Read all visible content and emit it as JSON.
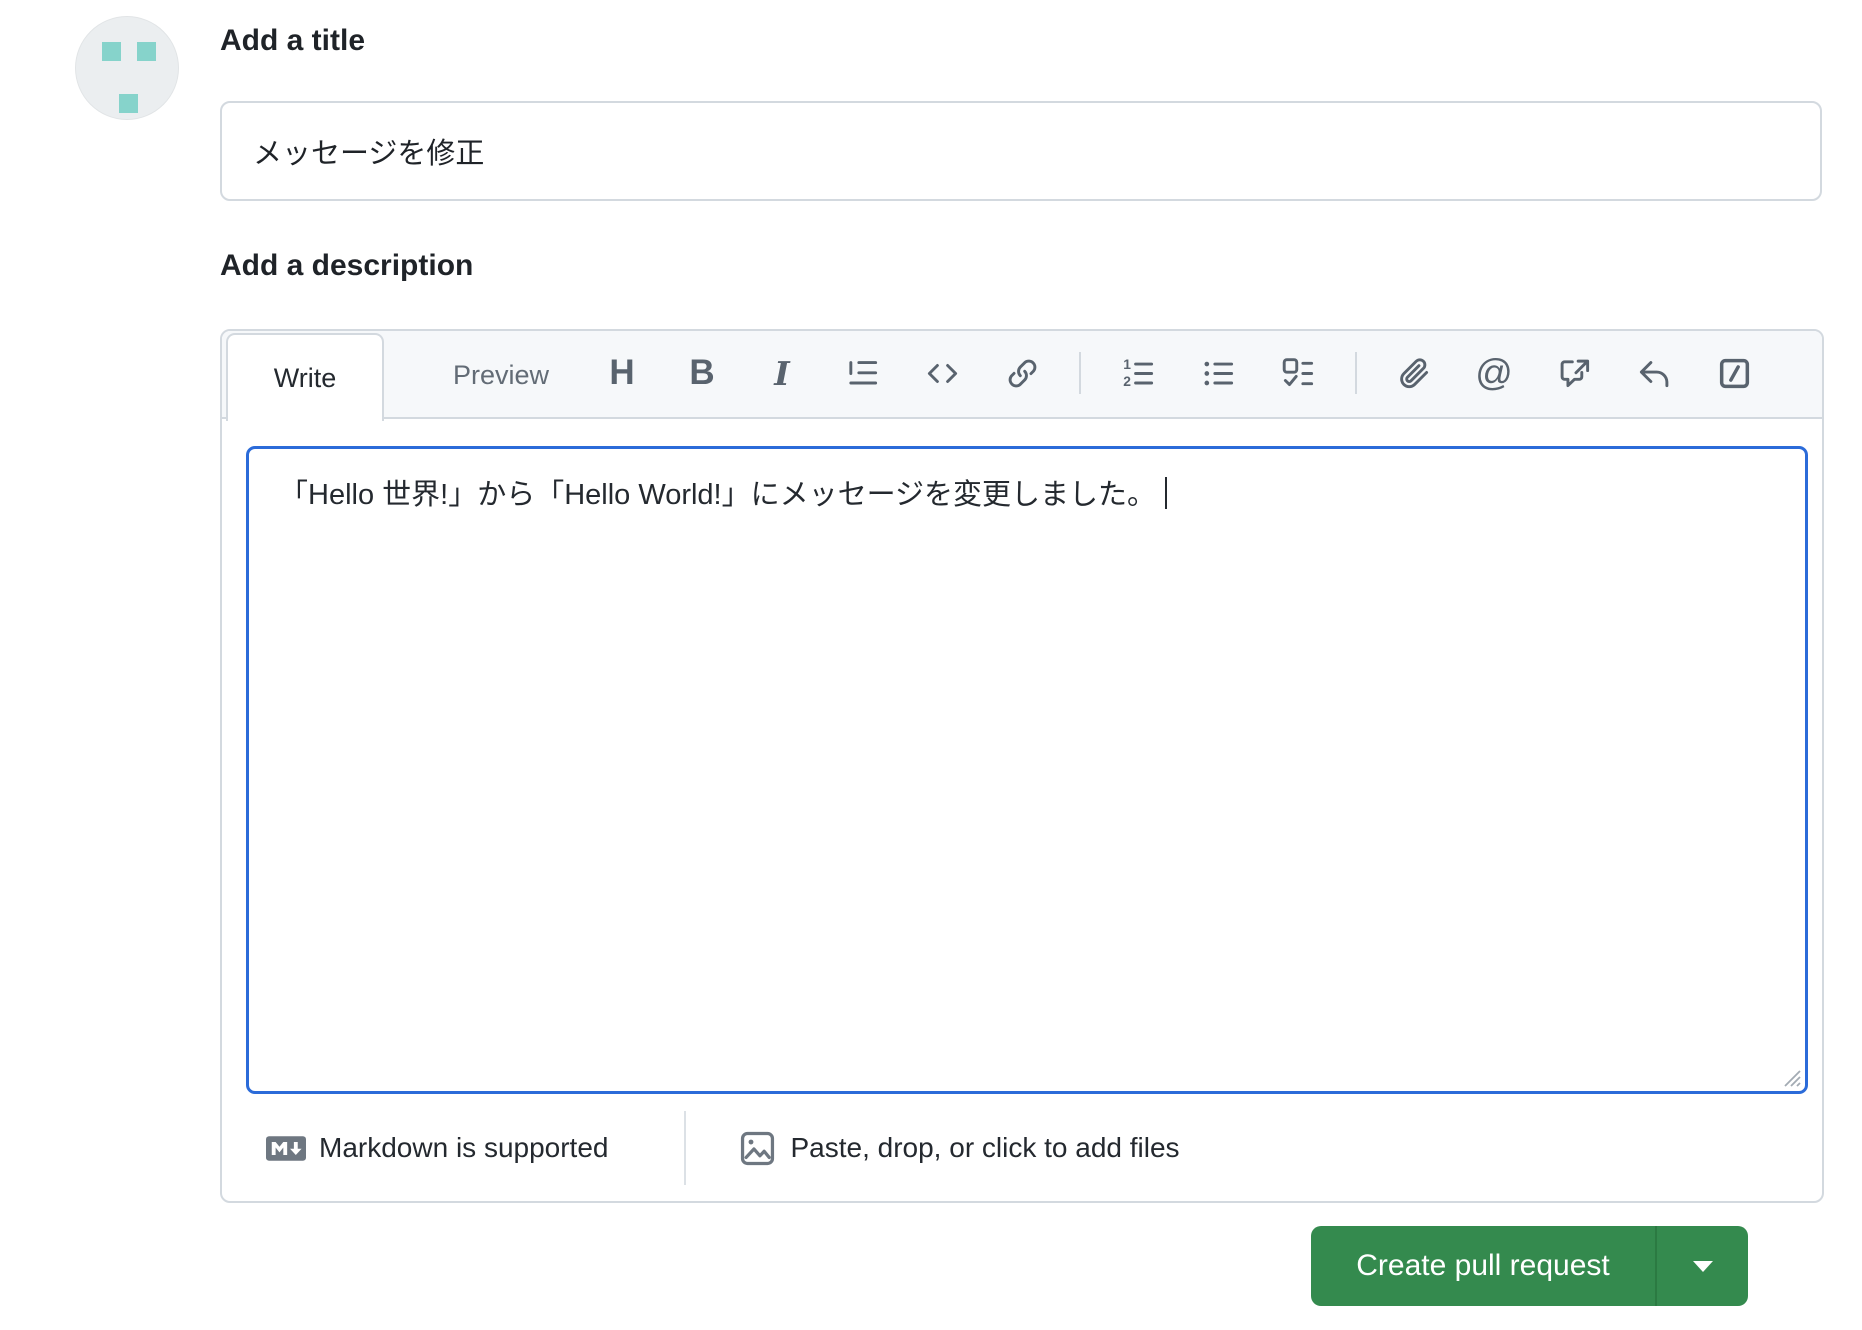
{
  "title_section": {
    "heading": "Add a title",
    "input_value": "メッセージを修正"
  },
  "description_section": {
    "heading": "Add a description",
    "tabs": {
      "write": "Write",
      "preview": "Preview"
    },
    "toolbar": {
      "heading_glyph": "H",
      "bold_glyph": "B",
      "italic_glyph": "I",
      "mention_glyph": "@",
      "icons": [
        "heading",
        "bold",
        "italic",
        "quote",
        "code",
        "link",
        "numbered-list",
        "bulleted-list",
        "task-list",
        "attach-file",
        "mention",
        "cross-reference",
        "reply",
        "slash-command"
      ]
    },
    "editor_text": "「Hello 世界!」から「Hello World!」にメッセージを変更しました。",
    "footer": {
      "markdown_hint": "Markdown is supported",
      "attach_hint": "Paste, drop, or click to add files"
    }
  },
  "actions": {
    "create_pull_request": "Create pull request"
  },
  "colors": {
    "button_green": "#348a4e",
    "button_divider_green": "#2b7a42",
    "focus_blue": "#2b6bd9",
    "border_gray": "#d3d9df",
    "header_bg": "#f6f8fa",
    "icon_gray": "#59636e",
    "muted_text": "#636c76",
    "footer_icon_gray": "#6e7781",
    "avatar_bg": "#ebeef0",
    "avatar_teal": "#86d3cb"
  }
}
